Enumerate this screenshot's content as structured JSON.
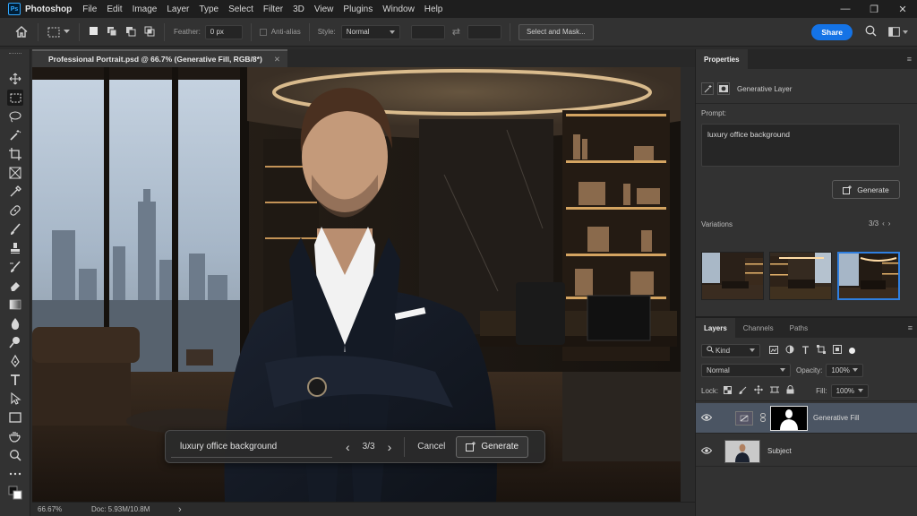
{
  "app": {
    "name": "Photoshop",
    "logo_text": "Ps"
  },
  "menu": [
    "File",
    "Edit",
    "Image",
    "Layer",
    "Type",
    "Select",
    "Filter",
    "3D",
    "View",
    "Plugins",
    "Window",
    "Help"
  ],
  "window_controls": {
    "minimize": "—",
    "restore": "❐",
    "close": "✕"
  },
  "options_bar": {
    "feather_label": "Feather:",
    "feather_value": "0 px",
    "antialias_label": "Anti-alias",
    "style_label": "Style:",
    "style_value": "Normal",
    "select_mask_label": "Select and Mask...",
    "share_label": "Share"
  },
  "document_tab": {
    "title": "Professional Portrait.psd @ 66.7% (Generative Fill, RGB/8*)",
    "close": "✕"
  },
  "status_bar": {
    "zoom": "66.67%",
    "doc": "Doc: 5.93M/10.8M",
    "arrow": "›"
  },
  "generative_bar": {
    "prompt": "luxury office background",
    "prev": "‹",
    "counter": "3/3",
    "next": "›",
    "cancel_label": "Cancel",
    "generate_label": "Generate"
  },
  "properties": {
    "tab_label": "Properties",
    "layer_type": "Generative Layer",
    "prompt_label": "Prompt:",
    "prompt_value": "luxury office background",
    "generate_label": "Generate",
    "variations_label": "Variations",
    "variations_counter": "3/3",
    "prev": "‹",
    "next": "›",
    "selected_variation": 3
  },
  "layers_panel": {
    "tabs": [
      "Layers",
      "Channels",
      "Paths"
    ],
    "filter_label": "Kind",
    "blend_mode": "Normal",
    "opacity_label": "Opacity:",
    "opacity_value": "100%",
    "lock_label": "Lock:",
    "fill_label": "Fill:",
    "fill_value": "100%",
    "layers": [
      {
        "name": "Generative Fill",
        "selected": true
      },
      {
        "name": "Subject",
        "selected": false
      }
    ]
  },
  "colors": {
    "accent": "#1473e6",
    "selection": "#2f7fe0",
    "panel": "#323232",
    "menubar": "#1e1e1e"
  }
}
